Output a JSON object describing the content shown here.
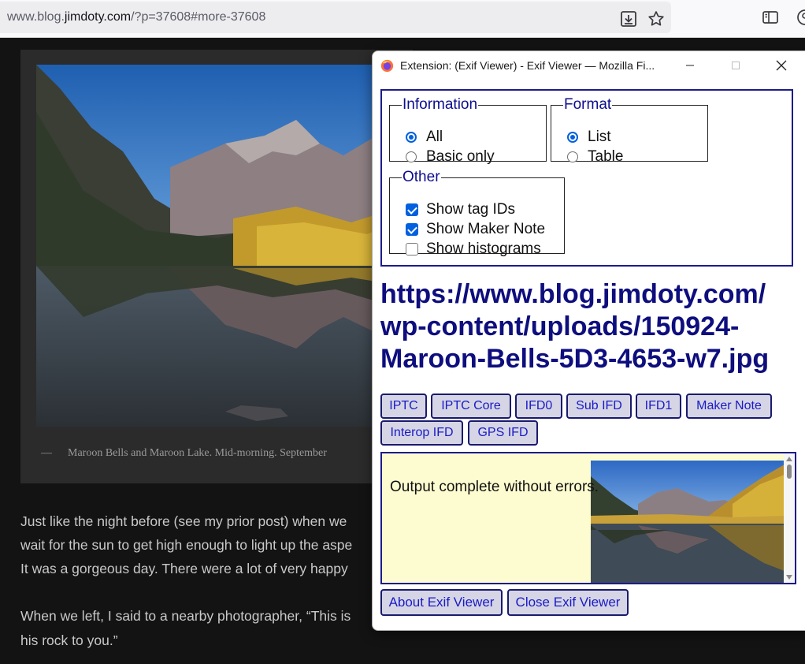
{
  "browser": {
    "url_prefix": "www.blog.",
    "url_domain": "jimdoty.com",
    "url_suffix": "/?p=37608#more-37608"
  },
  "blog": {
    "caption_dash": "—",
    "caption": "Maroon Bells and Maroon Lake. Mid-morning. September",
    "paragraph_lines": [
      "Just like the night before (see my prior post) when we",
      "wait for the sun to get high enough to light up the aspe",
      "It was a gorgeous day. There were a lot of very happy"
    ],
    "paragraph2_lines": [
      "When we left, I said to a nearby photographer, “This is",
      "his rock to you.”"
    ]
  },
  "popup": {
    "title": "Extension: (Exif Viewer) - Exif Viewer — Mozilla Fi...",
    "information": {
      "legend": "Information",
      "options": [
        {
          "label": "All",
          "selected": true
        },
        {
          "label": "Basic only",
          "selected": false
        }
      ]
    },
    "format": {
      "legend": "Format",
      "options": [
        {
          "label": "List",
          "selected": true
        },
        {
          "label": "Table",
          "selected": false
        }
      ]
    },
    "other": {
      "legend": "Other",
      "options": [
        {
          "label": "Show tag IDs",
          "checked": true
        },
        {
          "label": "Show Maker Note",
          "checked": true
        },
        {
          "label": "Show histograms",
          "checked": false
        }
      ]
    },
    "image_url_lines": [
      "https://www.blog.jimdoty.com/",
      "wp-content/uploads/150924-",
      "Maroon-Bells-5D3-4653-w7.jpg"
    ],
    "tabs": [
      "IPTC",
      "IPTC Core",
      "IFD0",
      "Sub IFD",
      "IFD1",
      "Maker Note",
      "Interop IFD",
      "GPS IFD"
    ],
    "output_text": "Output complete without errors.",
    "about_button": "About Exif Viewer",
    "close_button": "Close Exif Viewer"
  },
  "colors": {
    "window_accent": "#1b1b8c",
    "button_bg": "#d5d5e5",
    "button_text": "#1a1ac8",
    "output_bg": "#fdfcd0",
    "url_text": "#0e0e7e",
    "radio_checked": "#0060df"
  },
  "icons": [
    "download-icon",
    "bookmark-star-icon",
    "sidebar-icon",
    "account-icon",
    "firefox-logo-icon",
    "minimize-icon",
    "maximize-icon",
    "close-icon"
  ]
}
